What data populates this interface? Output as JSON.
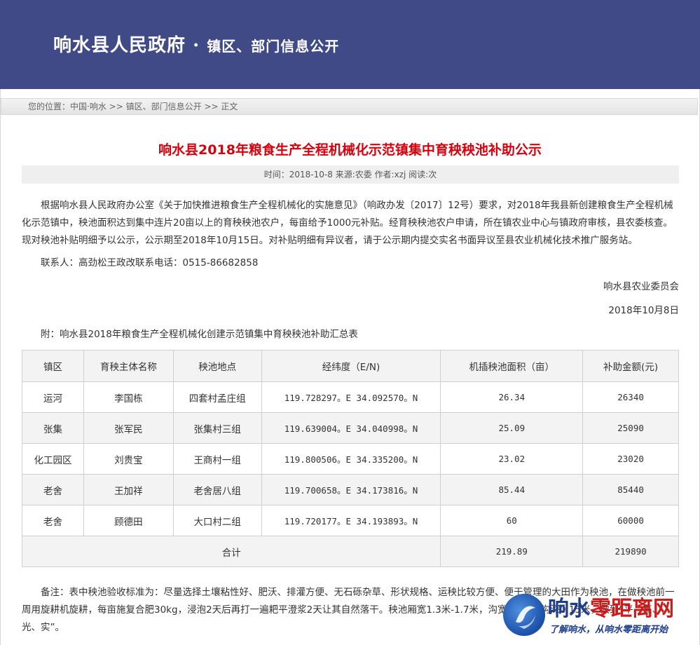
{
  "header": {
    "site_title": "响水县人民政府",
    "dot": "·",
    "site_subtitle": "镇区、部门信息公开"
  },
  "breadcrumb": {
    "prefix": "您的位置：",
    "items": [
      "中国·响水",
      "镇区、部门信息公开",
      "正文"
    ],
    "separator": ">>"
  },
  "article": {
    "title": "响水县2018年粮食生产全程机械化示范镇集中育秧秧池补助公示",
    "meta": "时间：2018-10-8  来源:农委  作者:xzj  阅读:次",
    "body": "根据响水县人民政府办公室《关于加快推进粮食生产全程机械化的实施意见》（响政办发〔2017〕12号）要求，对2018年我县新创建粮食生产全程机械化示范镇中，秧池面积达到集中连片20亩以上的育秧秧池农户，每亩给予1000元补贴。经育秧秧池农户申请，所在镇农业中心与镇政府审核，县农委核查。现对秧池补贴明细予以公示，公示期至2018年10月15日。对补贴明细有异议者，请于公示期内提交实名书面异议至县农业机械化技术推广服务站。",
    "contact": "联系人：高劲松王政改联系电话：0515-86682858",
    "signer": "响水县农业委员会",
    "date": "2018年10月8日",
    "attachment_title": "附：响水县2018年粮食生产全程机械化创建示范镇集中育秧秧池补助汇总表",
    "note": "备注：表中秧池验收标准为：尽量选择土壤粘性好、肥沃、排灌方便、无石砾杂草、形状规格、运秧比较方便、便于管理的大田作为秧池，在做秧池前一周用旋耕机旋耕，每亩施复合肥30kg，浸泡2天后再打一遍耙平澄浆2天让其自然落干。秧池厢宽1.3米-1.7米，沟宽0.3米，沟深0.15米，做到“平、直、光、实”。"
  },
  "table": {
    "headers": [
      "镇区",
      "育秧主体名称",
      "秧池地点",
      "经纬度（E/N)",
      "机插秧池面积（亩）",
      "补助金额(元)"
    ],
    "rows": [
      [
        "运河",
        "李国栋",
        "四套村孟庄组",
        "119.728297。E 34.092570。N",
        "26.34",
        "26340"
      ],
      [
        "张集",
        "张军民",
        "张集村三组",
        "119.639004。E 34.040998。N",
        "25.09",
        "25090"
      ],
      [
        "化工园区",
        "刘贵宝",
        "王商村一组",
        "119.800506。E 34.335200。N",
        "23.02",
        "23020"
      ],
      [
        "老舍",
        "王加祥",
        "老舍居八组",
        "119.700658。E 34.173816。N",
        "85.44",
        "85440"
      ],
      [
        "老舍",
        "顾德田",
        "大口村二组",
        "119.720177。E 34.193893。N",
        "60",
        "60000"
      ]
    ],
    "total_label": "合计",
    "total_area": "219.89",
    "total_amount": "219890"
  },
  "watermark": {
    "part1": "响水",
    "part2": "零距离网",
    "slogan": "了解响水，从响水零距离开始"
  }
}
